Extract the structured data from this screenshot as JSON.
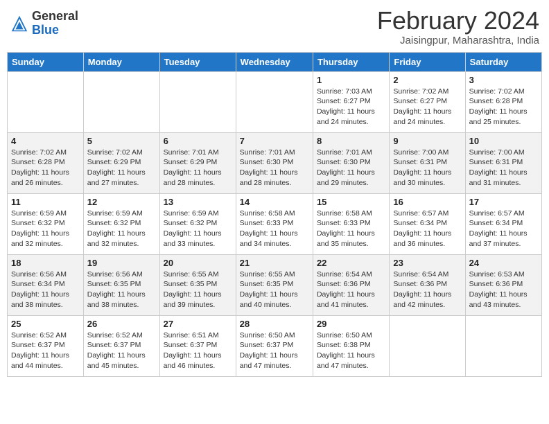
{
  "logo": {
    "general": "General",
    "blue": "Blue"
  },
  "title": "February 2024",
  "location": "Jaisingpur, Maharashtra, India",
  "weekdays": [
    "Sunday",
    "Monday",
    "Tuesday",
    "Wednesday",
    "Thursday",
    "Friday",
    "Saturday"
  ],
  "weeks": [
    [
      {
        "day": "",
        "info": ""
      },
      {
        "day": "",
        "info": ""
      },
      {
        "day": "",
        "info": ""
      },
      {
        "day": "",
        "info": ""
      },
      {
        "day": "1",
        "info": "Sunrise: 7:03 AM\nSunset: 6:27 PM\nDaylight: 11 hours and 24 minutes."
      },
      {
        "day": "2",
        "info": "Sunrise: 7:02 AM\nSunset: 6:27 PM\nDaylight: 11 hours and 24 minutes."
      },
      {
        "day": "3",
        "info": "Sunrise: 7:02 AM\nSunset: 6:28 PM\nDaylight: 11 hours and 25 minutes."
      }
    ],
    [
      {
        "day": "4",
        "info": "Sunrise: 7:02 AM\nSunset: 6:28 PM\nDaylight: 11 hours and 26 minutes."
      },
      {
        "day": "5",
        "info": "Sunrise: 7:02 AM\nSunset: 6:29 PM\nDaylight: 11 hours and 27 minutes."
      },
      {
        "day": "6",
        "info": "Sunrise: 7:01 AM\nSunset: 6:29 PM\nDaylight: 11 hours and 28 minutes."
      },
      {
        "day": "7",
        "info": "Sunrise: 7:01 AM\nSunset: 6:30 PM\nDaylight: 11 hours and 28 minutes."
      },
      {
        "day": "8",
        "info": "Sunrise: 7:01 AM\nSunset: 6:30 PM\nDaylight: 11 hours and 29 minutes."
      },
      {
        "day": "9",
        "info": "Sunrise: 7:00 AM\nSunset: 6:31 PM\nDaylight: 11 hours and 30 minutes."
      },
      {
        "day": "10",
        "info": "Sunrise: 7:00 AM\nSunset: 6:31 PM\nDaylight: 11 hours and 31 minutes."
      }
    ],
    [
      {
        "day": "11",
        "info": "Sunrise: 6:59 AM\nSunset: 6:32 PM\nDaylight: 11 hours and 32 minutes."
      },
      {
        "day": "12",
        "info": "Sunrise: 6:59 AM\nSunset: 6:32 PM\nDaylight: 11 hours and 32 minutes."
      },
      {
        "day": "13",
        "info": "Sunrise: 6:59 AM\nSunset: 6:32 PM\nDaylight: 11 hours and 33 minutes."
      },
      {
        "day": "14",
        "info": "Sunrise: 6:58 AM\nSunset: 6:33 PM\nDaylight: 11 hours and 34 minutes."
      },
      {
        "day": "15",
        "info": "Sunrise: 6:58 AM\nSunset: 6:33 PM\nDaylight: 11 hours and 35 minutes."
      },
      {
        "day": "16",
        "info": "Sunrise: 6:57 AM\nSunset: 6:34 PM\nDaylight: 11 hours and 36 minutes."
      },
      {
        "day": "17",
        "info": "Sunrise: 6:57 AM\nSunset: 6:34 PM\nDaylight: 11 hours and 37 minutes."
      }
    ],
    [
      {
        "day": "18",
        "info": "Sunrise: 6:56 AM\nSunset: 6:34 PM\nDaylight: 11 hours and 38 minutes."
      },
      {
        "day": "19",
        "info": "Sunrise: 6:56 AM\nSunset: 6:35 PM\nDaylight: 11 hours and 38 minutes."
      },
      {
        "day": "20",
        "info": "Sunrise: 6:55 AM\nSunset: 6:35 PM\nDaylight: 11 hours and 39 minutes."
      },
      {
        "day": "21",
        "info": "Sunrise: 6:55 AM\nSunset: 6:35 PM\nDaylight: 11 hours and 40 minutes."
      },
      {
        "day": "22",
        "info": "Sunrise: 6:54 AM\nSunset: 6:36 PM\nDaylight: 11 hours and 41 minutes."
      },
      {
        "day": "23",
        "info": "Sunrise: 6:54 AM\nSunset: 6:36 PM\nDaylight: 11 hours and 42 minutes."
      },
      {
        "day": "24",
        "info": "Sunrise: 6:53 AM\nSunset: 6:36 PM\nDaylight: 11 hours and 43 minutes."
      }
    ],
    [
      {
        "day": "25",
        "info": "Sunrise: 6:52 AM\nSunset: 6:37 PM\nDaylight: 11 hours and 44 minutes."
      },
      {
        "day": "26",
        "info": "Sunrise: 6:52 AM\nSunset: 6:37 PM\nDaylight: 11 hours and 45 minutes."
      },
      {
        "day": "27",
        "info": "Sunrise: 6:51 AM\nSunset: 6:37 PM\nDaylight: 11 hours and 46 minutes."
      },
      {
        "day": "28",
        "info": "Sunrise: 6:50 AM\nSunset: 6:37 PM\nDaylight: 11 hours and 47 minutes."
      },
      {
        "day": "29",
        "info": "Sunrise: 6:50 AM\nSunset: 6:38 PM\nDaylight: 11 hours and 47 minutes."
      },
      {
        "day": "",
        "info": ""
      },
      {
        "day": "",
        "info": ""
      }
    ]
  ]
}
